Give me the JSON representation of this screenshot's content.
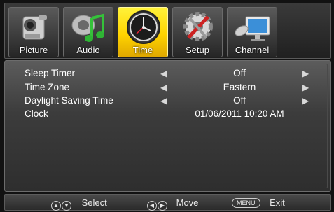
{
  "tabs": [
    {
      "label": "Picture",
      "icon": "camcorder-icon",
      "active": false
    },
    {
      "label": "Audio",
      "icon": "music-note-icon",
      "active": false
    },
    {
      "label": "Time",
      "icon": "clock-icon",
      "active": true
    },
    {
      "label": "Setup",
      "icon": "gear-tools-icon",
      "active": false
    },
    {
      "label": "Channel",
      "icon": "satellite-monitor-icon",
      "active": false
    }
  ],
  "settings": [
    {
      "name": "Sleep Timer",
      "value": "Off",
      "has_arrows": true
    },
    {
      "name": "Time Zone",
      "value": "Eastern",
      "has_arrows": true
    },
    {
      "name": "Daylight Saving Time",
      "value": "Off",
      "has_arrows": true
    },
    {
      "name": "Clock",
      "value": "01/06/2011 10:20 AM",
      "has_arrows": false
    }
  ],
  "footer": {
    "select_label": "Select",
    "move_label": "Move",
    "menu_key": "MENU",
    "exit_label": "Exit"
  },
  "colors": {
    "active_tab": "#ffd400",
    "text": "#ffffff",
    "background": "#121212"
  }
}
